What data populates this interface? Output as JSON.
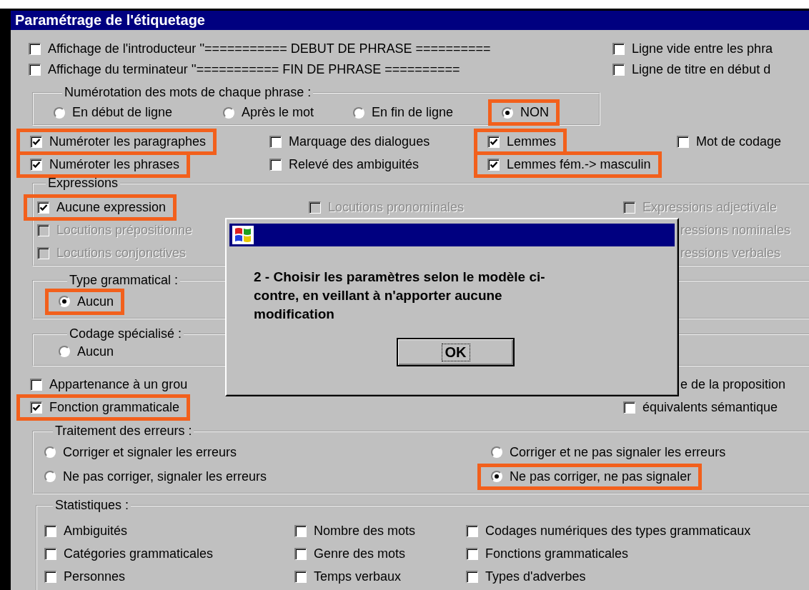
{
  "window": {
    "title": "Paramétrage de l'étiquetage"
  },
  "sections": [
    {
      "kind": "plain",
      "columns": [
        [
          {
            "kind": "checkbox",
            "label": "Affichage de l'introducteur ''=========== DEBUT DE PHRASE ==========",
            "checked": false,
            "disabled": false,
            "highlighted": false
          },
          {
            "kind": "checkbox",
            "label": "Affichage du terminateur ''=========== FIN DE PHRASE ==========",
            "checked": false,
            "disabled": false,
            "highlighted": false
          }
        ],
        [
          {
            "kind": "checkbox",
            "label": "Ligne vide entre les phra",
            "checked": false,
            "disabled": false,
            "highlighted": false
          },
          {
            "kind": "checkbox",
            "label": "Ligne de titre en début d",
            "checked": false,
            "disabled": false,
            "highlighted": false
          }
        ]
      ]
    },
    {
      "kind": "group",
      "title": "Numérotation des mots de chaque phrase :",
      "columns": [
        [
          {
            "kind": "radio",
            "label": "En début de ligne",
            "selected": false,
            "disabled": false,
            "highlighted": false
          }
        ],
        [
          {
            "kind": "radio",
            "label": "Après le mot",
            "selected": false,
            "disabled": false,
            "highlighted": false
          }
        ],
        [
          {
            "kind": "radio",
            "label": "En fin de ligne",
            "selected": false,
            "disabled": false,
            "highlighted": false
          }
        ],
        [
          {
            "kind": "radio",
            "label": "NON",
            "selected": true,
            "disabled": false,
            "highlighted": true
          }
        ]
      ]
    },
    {
      "kind": "plain",
      "columns": [
        [
          {
            "kind": "checkbox",
            "label": "Numéroter les paragraphes",
            "checked": true,
            "disabled": false,
            "highlighted": true
          },
          {
            "kind": "checkbox",
            "label": "Numéroter les phrases",
            "checked": true,
            "disabled": false,
            "highlighted": true
          }
        ],
        [
          {
            "kind": "checkbox",
            "label": "Marquage des dialogues",
            "checked": false,
            "disabled": false,
            "highlighted": false
          },
          {
            "kind": "checkbox",
            "label": "Relevé des ambiguités",
            "checked": false,
            "disabled": false,
            "highlighted": false
          }
        ],
        [
          {
            "kind": "checkbox",
            "label": "Lemmes",
            "checked": true,
            "disabled": false,
            "highlighted": true
          },
          {
            "kind": "checkbox",
            "label": "Lemmes fém.-> masculin",
            "checked": true,
            "disabled": false,
            "highlighted": true
          }
        ],
        [
          {
            "kind": "checkbox",
            "label": "Mot de codage",
            "checked": false,
            "disabled": false,
            "highlighted": false
          }
        ]
      ]
    },
    {
      "kind": "group",
      "title": "Expressions",
      "columns": [
        [
          {
            "kind": "checkbox",
            "label": "Aucune expression",
            "checked": true,
            "disabled": false,
            "highlighted": true
          },
          {
            "kind": "checkbox",
            "label": "Locutions prépositionne",
            "checked": false,
            "disabled": true,
            "highlighted": false
          },
          {
            "kind": "checkbox",
            "label": "Locutions conjonctives",
            "checked": false,
            "disabled": true,
            "highlighted": false
          }
        ],
        [
          {
            "kind": "checkbox",
            "label": "Locutions pronominales",
            "checked": false,
            "disabled": true,
            "highlighted": false
          }
        ],
        [
          {
            "kind": "checkbox",
            "label": "Expressions adjectivale",
            "checked": false,
            "disabled": true,
            "highlighted": false
          },
          {
            "kind": "fragment",
            "label": "ressions nominales",
            "disabled": true
          },
          {
            "kind": "fragment",
            "label": "ressions verbales",
            "disabled": true
          }
        ]
      ]
    },
    {
      "kind": "group",
      "title": "Type grammatical :",
      "columns": [
        [
          {
            "kind": "radio",
            "label": "Aucun",
            "selected": true,
            "disabled": false,
            "highlighted": true
          }
        ]
      ]
    },
    {
      "kind": "group",
      "title": "Codage spécialisé :",
      "columns": [
        [
          {
            "kind": "radio",
            "label": "Aucun",
            "selected": false,
            "disabled": false,
            "highlighted": false
          }
        ]
      ]
    },
    {
      "kind": "plain",
      "columns": [
        [
          {
            "kind": "checkbox",
            "label": "Appartenance à un grou",
            "checked": false,
            "disabled": false,
            "highlighted": false
          },
          {
            "kind": "checkbox",
            "label": "Fonction grammaticale",
            "checked": true,
            "disabled": false,
            "highlighted": true
          }
        ],
        [
          {
            "kind": "fragment",
            "label": "e de la proposition",
            "disabled": false
          },
          {
            "kind": "checkbox",
            "label": "équivalents sémantique",
            "checked": false,
            "disabled": false,
            "highlighted": false
          }
        ]
      ]
    },
    {
      "kind": "group",
      "title": "Traitement des erreurs :",
      "columns": [
        [
          {
            "kind": "radio",
            "label": "Corriger et signaler les erreurs",
            "selected": false,
            "disabled": false,
            "highlighted": false
          },
          {
            "kind": "radio",
            "label": "Ne pas corriger, signaler les erreurs",
            "selected": false,
            "disabled": false,
            "highlighted": false
          }
        ],
        [
          {
            "kind": "radio",
            "label": "Corriger et ne pas signaler les erreurs",
            "selected": false,
            "disabled": false,
            "highlighted": false
          },
          {
            "kind": "radio",
            "label": "Ne pas corriger, ne pas signaler",
            "selected": true,
            "disabled": false,
            "highlighted": true
          }
        ]
      ]
    },
    {
      "kind": "group",
      "title": "Statistiques :",
      "columns": [
        [
          {
            "kind": "checkbox",
            "label": "Ambiguités",
            "checked": false,
            "disabled": false,
            "highlighted": false
          },
          {
            "kind": "checkbox",
            "label": "Catégories grammaticales",
            "checked": false,
            "disabled": false,
            "highlighted": false
          },
          {
            "kind": "checkbox",
            "label": "Personnes",
            "checked": false,
            "disabled": false,
            "highlighted": false
          }
        ],
        [
          {
            "kind": "checkbox",
            "label": "Nombre des mots",
            "checked": false,
            "disabled": false,
            "highlighted": false
          },
          {
            "kind": "checkbox",
            "label": "Genre des mots",
            "checked": false,
            "disabled": false,
            "highlighted": false
          },
          {
            "kind": "checkbox",
            "label": "Temps verbaux",
            "checked": false,
            "disabled": false,
            "highlighted": false
          }
        ],
        [
          {
            "kind": "checkbox",
            "label": "Codages numériques des types grammaticaux",
            "checked": false,
            "disabled": false,
            "highlighted": false
          },
          {
            "kind": "checkbox",
            "label": "Fonctions grammaticales",
            "checked": false,
            "disabled": false,
            "highlighted": false
          },
          {
            "kind": "checkbox",
            "label": "Types d'adverbes",
            "checked": false,
            "disabled": false,
            "highlighted": false
          }
        ]
      ]
    }
  ],
  "message_box": {
    "message": "2 - Choisir les paramètres selon le modèle ci-contre, en veillant à n'apporter aucune modification",
    "button": "OK"
  }
}
